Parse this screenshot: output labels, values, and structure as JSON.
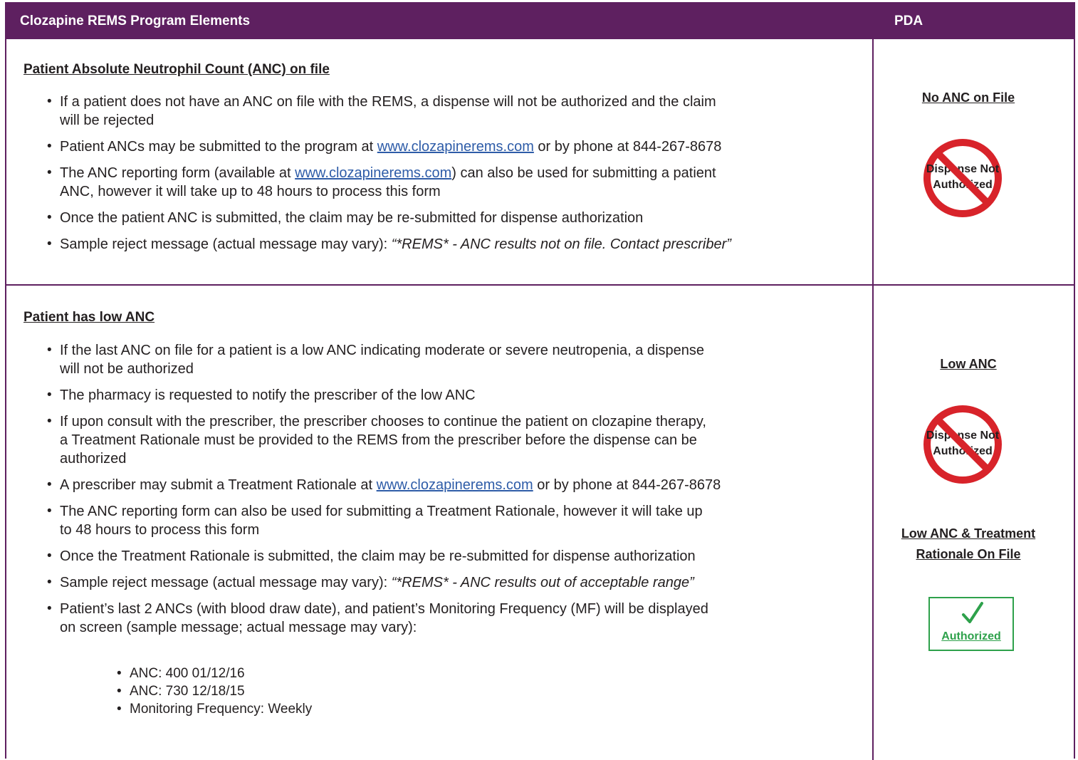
{
  "header": {
    "left_title": "Clozapine REMS Program Elements",
    "right_title": "PDA"
  },
  "section1": {
    "title": "Patient Absolute Neutrophil Count (ANC) on file",
    "b1_line1": "If a patient does not have an ANC on file with the REMS, a dispense will not be authorized and the claim",
    "b1_line2": " will be rejected",
    "b2_pre": "Patient ANCs may be submitted to the program at ",
    "b2_link": "www.clozapinerems.com",
    "b2_post": " or by phone at 844-267-8678",
    "b3_pre": "The ANC reporting form (available at ",
    "b3_link": "www.clozapinerems.com",
    "b3_post": ") can also be used for submitting a patient",
    "b3_line2": "ANC, however it will take up to 48 hours to process this form",
    "b4": "Once the patient ANC is submitted, the claim may be re-submitted for dispense authorization",
    "b5_pre": "Sample reject message (actual message may vary): ",
    "b5_italic": "“*REMS* - ANC results not on file. Contact prescriber”"
  },
  "section2": {
    "title": "Patient has low ANC",
    "b1_line1": "If the last ANC on file for a patient is a low ANC indicating moderate or severe neutropenia, a dispense",
    "b1_line2": "will not be authorized",
    "b2": "The pharmacy is requested to notify the prescriber of the low ANC",
    "b3_line1": "If upon consult with the prescriber, the prescriber chooses to continue the patient on clozapine therapy,",
    "b3_line2": "a Treatment Rationale must be provided to the REMS from the prescriber before the dispense can be",
    "b3_line3": "authorized",
    "b4_pre": "A prescriber may submit a Treatment Rationale at ",
    "b4_link": "www.clozapinerems.com",
    "b4_post": " or by phone at 844-267-8678",
    "b5_line1": "The ANC reporting form can also be used for submitting a Treatment Rationale, however it will take up",
    "b5_line2": "to 48 hours to process this form",
    "b6": "Once the Treatment Rationale is submitted, the claim may be re-submitted for dispense authorization",
    "b7_pre": "Sample reject message (actual message may vary): ",
    "b7_italic": "“*REMS* - ANC results out of acceptable range”",
    "b8_line1": "Patient’s last 2 ANCs (with blood draw date), and patient’s Monitoring Frequency (MF) will be displayed",
    "b8_line2": "on screen (sample message; actual message may vary):",
    "sub_items": [
      "ANC:  400 01/12/16",
      "ANC:  730 12/18/15",
      "Monitoring Frequency:  Weekly"
    ]
  },
  "pda": {
    "label1": "No ANC on File",
    "sign1_line1": "Dispense Not",
    "sign1_line2": "Authorized",
    "label2": "Low ANC",
    "sign2_line1": "Dispense Not",
    "sign2_line2": "Authorized",
    "label3_line1": "Low ANC & Treatment",
    "label3_line2": "Rationale On File",
    "authorized": "Authorized",
    "no_sign_icon": "prohibited-sign-icon",
    "check_icon": "checkmark-icon"
  },
  "colors": {
    "header_purple": "#5e2060",
    "link_blue": "#2e5ca8",
    "prohibit_red": "#d8232a",
    "authorized_green": "#2ea14b"
  }
}
